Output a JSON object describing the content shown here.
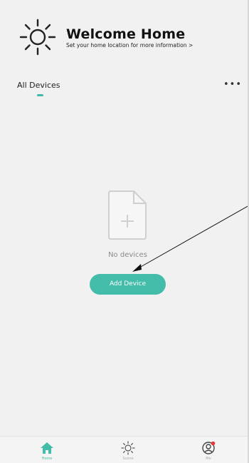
{
  "header": {
    "title": "Welcome Home",
    "subtitle": "Set your home location for more information",
    "subtitle_chevron": ">",
    "icon": "sun-icon"
  },
  "tabs": {
    "active_label": "All Devices",
    "more_label": "•••"
  },
  "empty_state": {
    "icon": "add-file-icon",
    "message": "No devices",
    "button_label": "Add Device"
  },
  "bottom_nav": [
    {
      "label": "Home",
      "icon": "home-icon",
      "active": true
    },
    {
      "label": "Scene",
      "icon": "sun-icon",
      "active": false
    },
    {
      "label": "Me",
      "icon": "profile-icon",
      "active": false,
      "badge": true
    }
  ],
  "colors": {
    "accent": "#43bca9",
    "background": "#f1f1f1",
    "badge": "#e23a3a"
  }
}
